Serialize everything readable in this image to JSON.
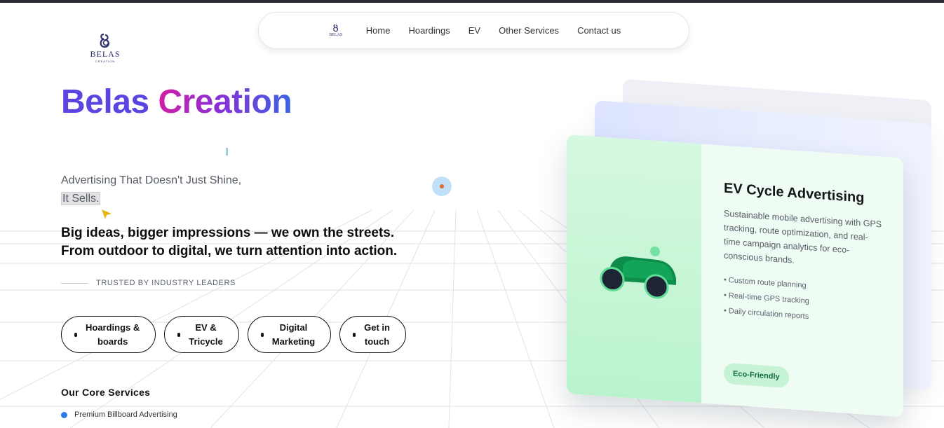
{
  "brand": {
    "logo_text": "BELAS",
    "logo_subtext": "CREATION",
    "nav_logo_text": "BELAS"
  },
  "nav": {
    "items": [
      "Home",
      "Hoardings",
      "EV",
      "Other Services",
      "Contact us"
    ]
  },
  "hero": {
    "title_word1": "Belas",
    "title_word2": "Creation",
    "tagline_line1": "Advertising That Doesn't Just Shine,",
    "tagline_line2": "It Sells.",
    "headline_line1": "Big ideas, bigger impressions — we own the streets.",
    "headline_line2": "From outdoor to digital, we turn attention into action.",
    "trusted": "TRUSTED BY INDUSTRY LEADERS"
  },
  "pills": [
    {
      "line1": "Hoardings &",
      "line2": "boards"
    },
    {
      "line1": "EV &",
      "line2": "Tricycle"
    },
    {
      "line1": "Digital",
      "line2": "Marketing"
    },
    {
      "line1": "Get in",
      "line2": "touch"
    }
  ],
  "core_services": {
    "title": "Our Core Services",
    "items": [
      "Premium Billboard Advertising"
    ]
  },
  "card": {
    "title": "EV Cycle Advertising",
    "description": "Sustainable mobile advertising with GPS tracking, route optimization, and real-time campaign analytics for eco-conscious brands.",
    "bullets": [
      "• Custom route planning",
      "• Real-time GPS tracking",
      "• Daily circulation reports"
    ],
    "badge": "Eco-Friendly"
  },
  "colors": {
    "title_purple": "#5b45e0",
    "gradient_pink": "#d21fa5",
    "gradient_blue": "#3b63e6",
    "badge_green": "#0f6b3b",
    "accent_blue": "#2f7be8"
  },
  "icons": [
    "belas-logo-icon",
    "cursor-arrow-icon",
    "ev-car-icon"
  ]
}
